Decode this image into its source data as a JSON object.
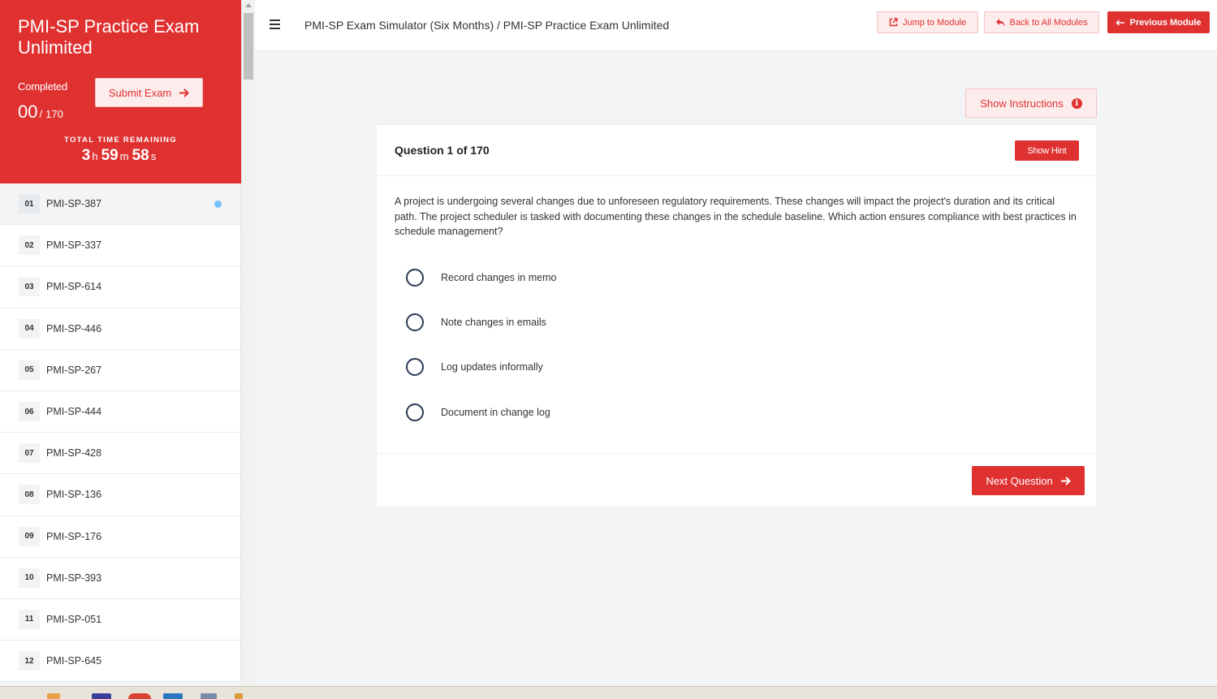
{
  "sidebar": {
    "exam_title": "PMI-SP Practice Exam Unlimited",
    "completed_label": "Completed",
    "completed_count": "00",
    "completed_sep": "/",
    "completed_total": "170",
    "submit_label": "Submit Exam",
    "time_label": "TOTAL TIME REMAINING",
    "time": {
      "h": "3",
      "h_unit": "h",
      "m": "59",
      "m_unit": "m",
      "s": "58",
      "s_unit": "s"
    },
    "questions": [
      {
        "num": "01",
        "code": "PMI-SP-387",
        "active": true
      },
      {
        "num": "02",
        "code": "PMI-SP-337"
      },
      {
        "num": "03",
        "code": "PMI-SP-614"
      },
      {
        "num": "04",
        "code": "PMI-SP-446"
      },
      {
        "num": "05",
        "code": "PMI-SP-267"
      },
      {
        "num": "06",
        "code": "PMI-SP-444"
      },
      {
        "num": "07",
        "code": "PMI-SP-428"
      },
      {
        "num": "08",
        "code": "PMI-SP-136"
      },
      {
        "num": "09",
        "code": "PMI-SP-176"
      },
      {
        "num": "10",
        "code": "PMI-SP-393"
      },
      {
        "num": "11",
        "code": "PMI-SP-051"
      },
      {
        "num": "12",
        "code": "PMI-SP-645"
      }
    ]
  },
  "topbar": {
    "breadcrumb": "PMI-SP Exam Simulator (Six Months) / PMI-SP Practice Exam Unlimited",
    "jump_label": "Jump to Module",
    "back_label": "Back to All Modules",
    "prev_label": "Previous Module"
  },
  "main": {
    "show_instructions_label": "Show Instructions",
    "question_title": "Question 1 of 170",
    "hint_label": "Show Hint",
    "question_text": "A project is undergoing several changes due to unforeseen regulatory requirements. These changes will impact the project's duration and its critical path. The project scheduler is tasked with documenting these changes in the schedule baseline. Which action ensures compliance with best practices in schedule management?",
    "options": [
      "Record changes in memo",
      "Note changes in emails",
      "Log updates informally",
      "Document in change log"
    ],
    "next_label": "Next Question"
  },
  "colors": {
    "brand": "#e03131",
    "brand_light": "#fdecec",
    "active_dot": "#74c0fc"
  }
}
